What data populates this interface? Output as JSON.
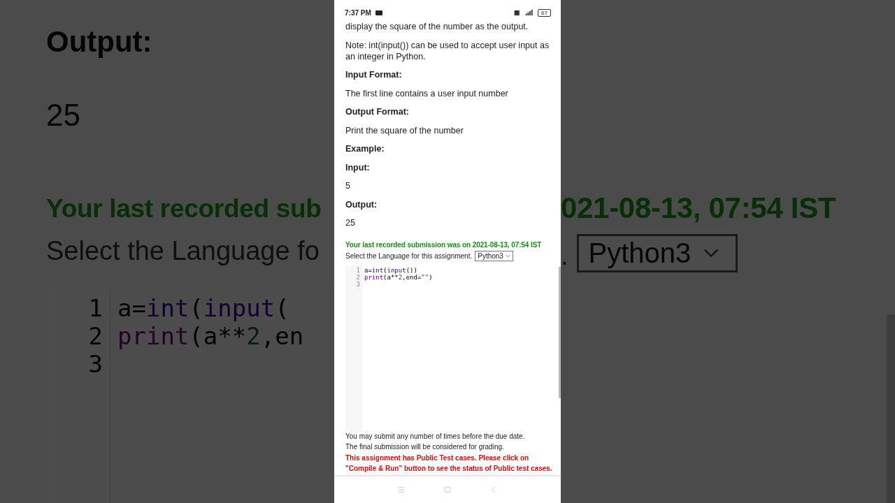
{
  "background": {
    "left": {
      "heading": "Output:",
      "value": "25",
      "submission": "Your last recorded sub",
      "language_prompt": "Select the Language fo",
      "code_lines": [
        {
          "number": "1",
          "tokens": [
            {
              "text": "a=",
              "kind": "plain"
            },
            {
              "text": "int",
              "kind": "builtin"
            },
            {
              "text": "(",
              "kind": "plain"
            },
            {
              "text": "input",
              "kind": "builtin"
            },
            {
              "text": "(",
              "kind": "plain"
            }
          ]
        },
        {
          "number": "2",
          "tokens": [
            {
              "text": "print",
              "kind": "keyword"
            },
            {
              "text": "(a**",
              "kind": "plain"
            },
            {
              "text": "2",
              "kind": "number"
            },
            {
              "text": ",en",
              "kind": "plain"
            }
          ]
        },
        {
          "number": "3"
        }
      ]
    },
    "right": {
      "submission": "021-08-13, 07:54 IST",
      "prompt_end": ".",
      "language_select": "Python3"
    }
  },
  "status_bar": {
    "time": "7:37 PM",
    "battery": "67"
  },
  "content": [
    {
      "kind": "text",
      "text": "display the square of the number as the output."
    },
    {
      "kind": "text",
      "text": "Note: int(input()) can be used to accept user input as an integer in Python."
    },
    {
      "kind": "heading",
      "text": "Input Format:"
    },
    {
      "kind": "text",
      "text": "The first line contains a user input number"
    },
    {
      "kind": "heading",
      "text": "Output Format:"
    },
    {
      "kind": "text",
      "text": "Print the square of the number"
    },
    {
      "kind": "heading",
      "text": "Example:"
    },
    {
      "kind": "heading",
      "text": "Input:"
    },
    {
      "kind": "text",
      "text": "5"
    },
    {
      "kind": "heading",
      "text": "Output:"
    },
    {
      "kind": "text",
      "text": "25"
    }
  ],
  "submission": "Your last recorded submission was on 2021-08-13, 07:54 IST",
  "language_prompt": "Select the Language for this assignment.",
  "language_select": "Python3",
  "editor": {
    "lines": [
      {
        "number": "1",
        "tokens": [
          {
            "text": "a=",
            "kind": "plain"
          },
          {
            "text": "int",
            "kind": "builtin"
          },
          {
            "text": "(",
            "kind": "plain"
          },
          {
            "text": "input",
            "kind": "builtin"
          },
          {
            "text": "())",
            "kind": "plain"
          }
        ]
      },
      {
        "number": "2",
        "tokens": [
          {
            "text": "print",
            "kind": "keyword"
          },
          {
            "text": "(a**",
            "kind": "plain"
          },
          {
            "text": "2",
            "kind": "number"
          },
          {
            "text": ",end=",
            "kind": "plain"
          },
          {
            "text": "\"\"",
            "kind": "string"
          },
          {
            "text": ")",
            "kind": "plain"
          }
        ]
      },
      {
        "number": "3"
      }
    ]
  },
  "notes": [
    {
      "kind": "info",
      "text": "You may submit any number of times before the due date."
    },
    {
      "kind": "info",
      "text": "The final submission will be considered for grading."
    },
    {
      "kind": "warning",
      "text": "This assignment has Public Test cases. Please click on \"Compile & Run\" button to see the status of Public test cases."
    }
  ]
}
